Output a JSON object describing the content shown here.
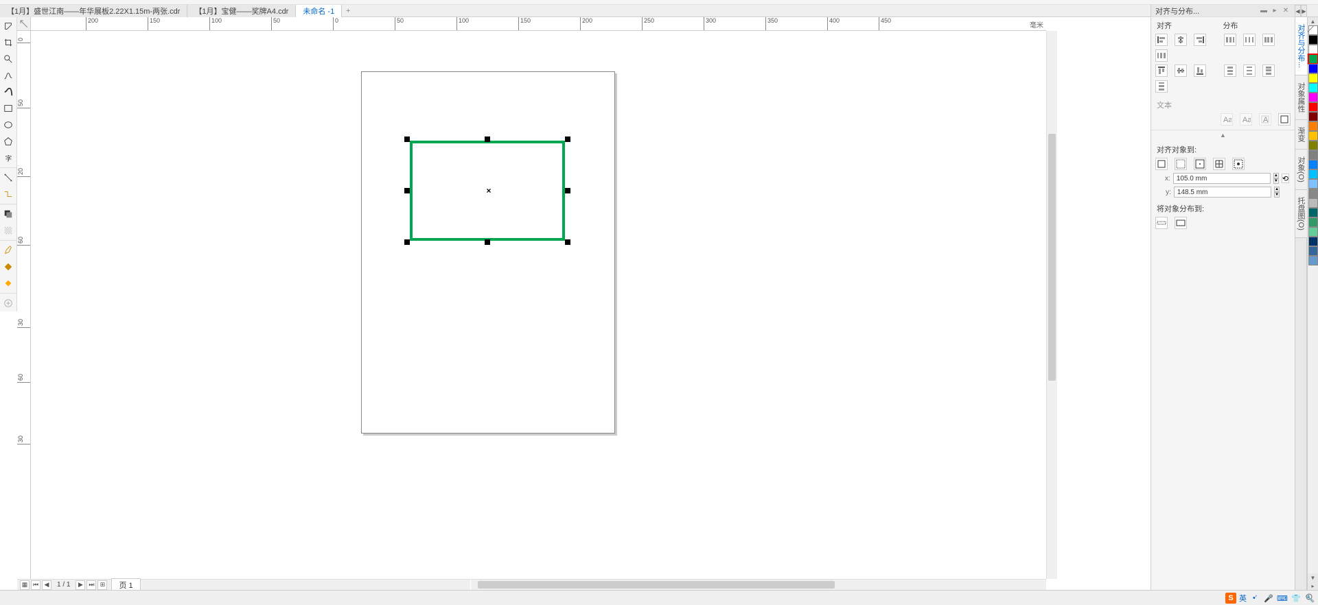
{
  "tabs": {
    "t0": "【1月】盛世江南——年华展板2.22X1.15m-两张.cdr",
    "t1": "【1月】宝健——奖牌A4.cdr",
    "t2": "未命名 -1"
  },
  "ruler_unit": "毫米",
  "h_ticks": [
    "200",
    "150",
    "100",
    "50",
    "0",
    "50",
    "100",
    "150",
    "200",
    "250",
    "300",
    "350",
    "400",
    "450"
  ],
  "v_ticks": [
    "0",
    "50",
    "20",
    "60",
    "30",
    "60",
    "30"
  ],
  "panel": {
    "title": "对齐与分布...",
    "align_lbl": "对齐",
    "distribute_lbl": "分布",
    "text_lbl": "文本",
    "align_to_lbl": "对齐对象到:",
    "coord_x_lbl": "x:",
    "coord_y_lbl": "y:",
    "coord_x_val": "105.0 mm",
    "coord_y_val": "148.5 mm",
    "distribute_to_lbl": "将对象分布到:"
  },
  "docker_tabs": {
    "d0": "对齐与分布...",
    "d1": "对象属性",
    "d2": "渐变",
    "d3": "对象(O)",
    "d4": "托盘图(O)"
  },
  "palette_colors": [
    "none",
    "#000000",
    "#ffffff",
    "#00a651",
    "#0000ff",
    "#ffff00",
    "#00ffff",
    "#ff00ff",
    "#ff0000",
    "#800000",
    "#ff8000",
    "#ffc000",
    "#808000",
    "#808080",
    "#0080ff",
    "#00c0ff",
    "#80c0ff",
    "#888888",
    "#bbbbbb",
    "#006666",
    "#339966",
    "#66cc99",
    "#003366",
    "#336699",
    "#6699cc"
  ],
  "page_nav": {
    "current": "1 / 1",
    "tab": "页 1"
  },
  "ime": {
    "text": "英"
  },
  "selection": {
    "rect_color": "#00a651"
  }
}
